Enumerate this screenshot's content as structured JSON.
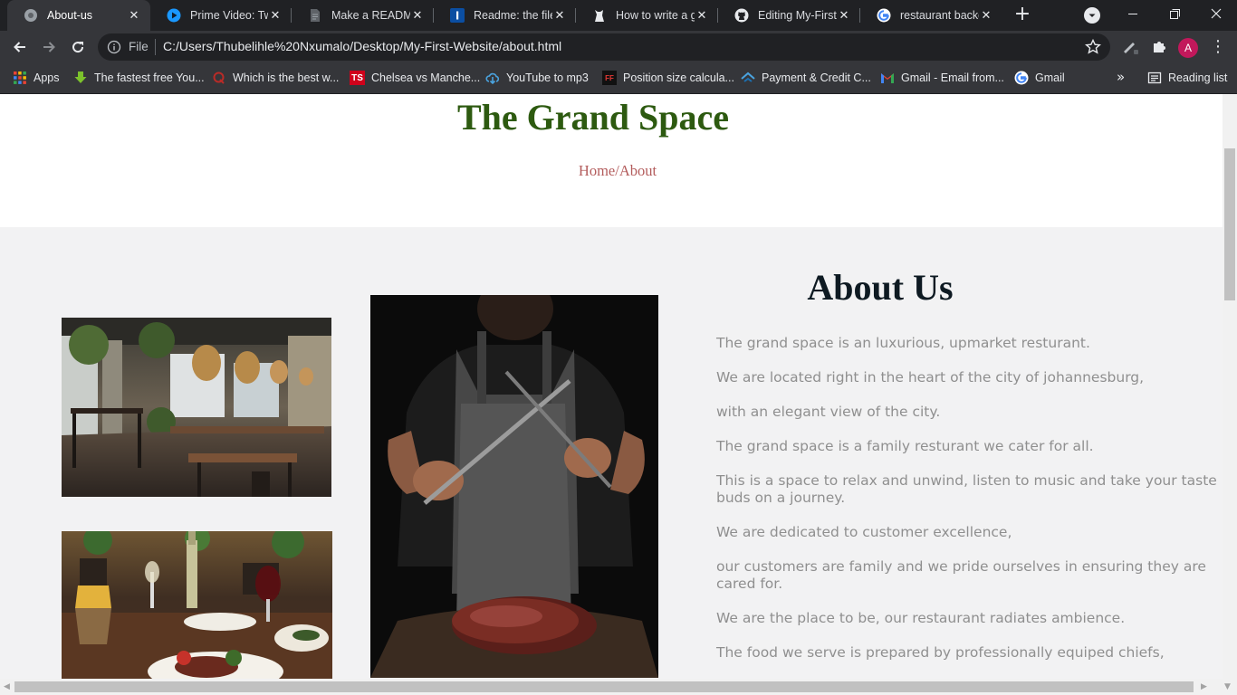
{
  "browser": {
    "tabs": [
      {
        "title": "About-us",
        "icon": "globe-icon",
        "active": true
      },
      {
        "title": "Prime Video: Two",
        "icon": "prime-video-icon"
      },
      {
        "title": "Make a README",
        "icon": "document-icon"
      },
      {
        "title": "Readme: the file t",
        "icon": "readme-icon"
      },
      {
        "title": "How to write a go",
        "icon": "dog-icon"
      },
      {
        "title": "Editing My-First-W",
        "icon": "github-icon"
      },
      {
        "title": "restaurant backgr",
        "icon": "google-icon"
      }
    ],
    "address": {
      "scheme_label": "File",
      "url": "C:/Users/Thubelihle%20Nxumalo/Desktop/My-First-Website/about.html"
    },
    "profile_initial": "A",
    "bookmarks": [
      {
        "label": "Apps",
        "icon": "apps-grid-icon"
      },
      {
        "label": "The fastest free You...",
        "icon": "download-arrow-icon"
      },
      {
        "label": "Which is the best w...",
        "icon": "quora-icon"
      },
      {
        "label": "Chelsea vs Manche...",
        "icon": "ts-icon"
      },
      {
        "label": "YouTube to mp3",
        "icon": "cloud-download-icon"
      },
      {
        "label": "Position size calcula...",
        "icon": "ff-icon"
      },
      {
        "label": "Payment & Credit C...",
        "icon": "payment-icon"
      },
      {
        "label": "Gmail - Email from...",
        "icon": "gmail-icon"
      },
      {
        "label": "Gmail",
        "icon": "google-icon"
      }
    ],
    "reading_list": "Reading list",
    "colors": {
      "frame": "#202124",
      "toolbar": "#35363a",
      "profile": "#c2185b"
    }
  },
  "page": {
    "site_title": "The Grand Space",
    "breadcrumb": "Home/About",
    "about_heading": "About Us",
    "about_lines": [
      "The grand space is an luxurious, upmarket resturant.",
      "We are located right in the heart of the city of johannesburg,",
      "with an elegant view of the city.",
      "The grand space is a family resturant we cater for all.",
      "This is a space to relax and unwind, listen to music and take your taste buds on a journey.",
      "We are dedicated to customer excellence,",
      "our customers are family and we pride ourselves in ensuring they are cared for.",
      "We are the place to be, our restaurant radiates ambience.",
      "The food we serve is prepared by professionally equiped chiefs,"
    ],
    "images": [
      {
        "name": "restaurant-interior-photo",
        "subject": "restaurant interior"
      },
      {
        "name": "chef-sharpening-knife-photo",
        "subject": "chef sharpening knife over steak"
      },
      {
        "name": "steak-dinner-photo",
        "subject": "steak dinner with wine"
      }
    ],
    "colors": {
      "title": "#2d5a10",
      "breadcrumb": "#b35c5c",
      "heading": "#0e1a22",
      "text": "#8f8f8f",
      "background": "#f2f2f3"
    }
  }
}
